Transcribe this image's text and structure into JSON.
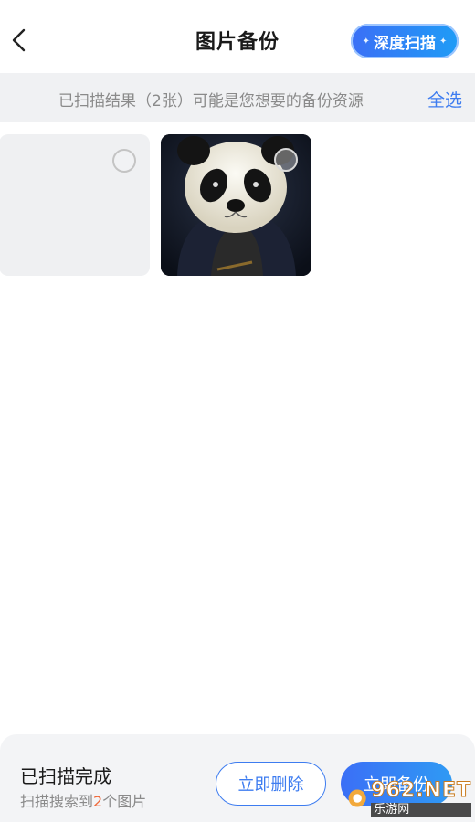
{
  "header": {
    "title": "图片备份",
    "deep_scan_label": "深度扫描",
    "back_icon": "chevron-left-icon"
  },
  "info_bar": {
    "text": "已扫描结果（2张）可能是您想要的备份资源",
    "select_all": "全选"
  },
  "images": [
    {
      "kind": "placeholder",
      "selected": false
    },
    {
      "kind": "photo",
      "subject": "panda",
      "selected": false
    }
  ],
  "bottom": {
    "status_title": "已扫描完成",
    "status_prefix": "扫描搜索到",
    "status_count": "2",
    "status_suffix": "个图片",
    "delete_label": "立即删除",
    "backup_label": "立即备份"
  },
  "watermark": {
    "brand": "962.NET",
    "site": "乐游网"
  },
  "colors": {
    "accent": "#3d7cf0",
    "count_highlight": "#f06a3b"
  }
}
